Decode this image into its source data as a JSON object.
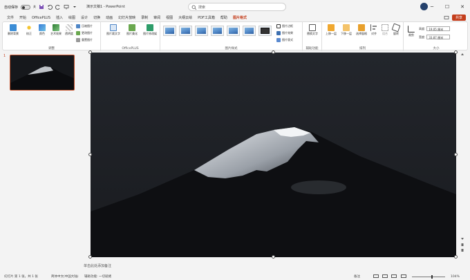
{
  "titlebar": {
    "autosave_label": "自动保存",
    "autosave_state": "关",
    "doc_title": "演示文稿1 - PowerPoint",
    "search_placeholder": "搜索"
  },
  "tabs": [
    "文件",
    "开始",
    "OfficePLUS",
    "插入",
    "绘图",
    "设计",
    "切换",
    "动画",
    "幻灯片放映",
    "录制",
    "审阅",
    "视图",
    "大纲云绘",
    "PDF工具箱",
    "帮助",
    "图片格式"
  ],
  "active_tab": "图片格式",
  "share_label": "共享",
  "ribbon": {
    "adjust": {
      "label": "调整",
      "remove_bg": "删除背景",
      "corrections": "校正",
      "color": "颜色",
      "artistic": "艺术效果",
      "transparency": "透明度",
      "compress": "压缩图片",
      "change": "更改图片",
      "reset": "重置图片"
    },
    "officeplus": {
      "label": "OfficePLUS",
      "pic_text": "图片裁文字",
      "pic_beauty": "图片美化",
      "pic_fix": "图片修改娱"
    },
    "styles": {
      "label": "图片样式",
      "border": "图片边框",
      "effects": "图片效果",
      "layout": "图片版式"
    },
    "accessibility": {
      "label": "辅助功能",
      "alt_text": "替换文字"
    },
    "arrange": {
      "label": "排列",
      "bring_forward": "上移一层",
      "send_backward": "下移一层",
      "selection_pane": "选择窗格",
      "align": "对齐",
      "group": "组合",
      "rotate": "旋转"
    },
    "size": {
      "label": "大小",
      "crop": "裁剪",
      "height_label": "高度:",
      "height_value": "19.05 厘米",
      "width_label": "宽度:",
      "width_value": "33.87 厘米"
    }
  },
  "slides_panel": {
    "slide_number": "1"
  },
  "notes_placeholder": "单击此处添加备注",
  "status": {
    "slide_info": "幻灯片 第 1 张，共 1 张",
    "language": "简体中文(中国大陆)",
    "accessibility": "辅助功能: 一切就绪",
    "notes_btn": "备注",
    "zoom": "104%"
  },
  "colors": {
    "accent": "#c43e1c"
  }
}
